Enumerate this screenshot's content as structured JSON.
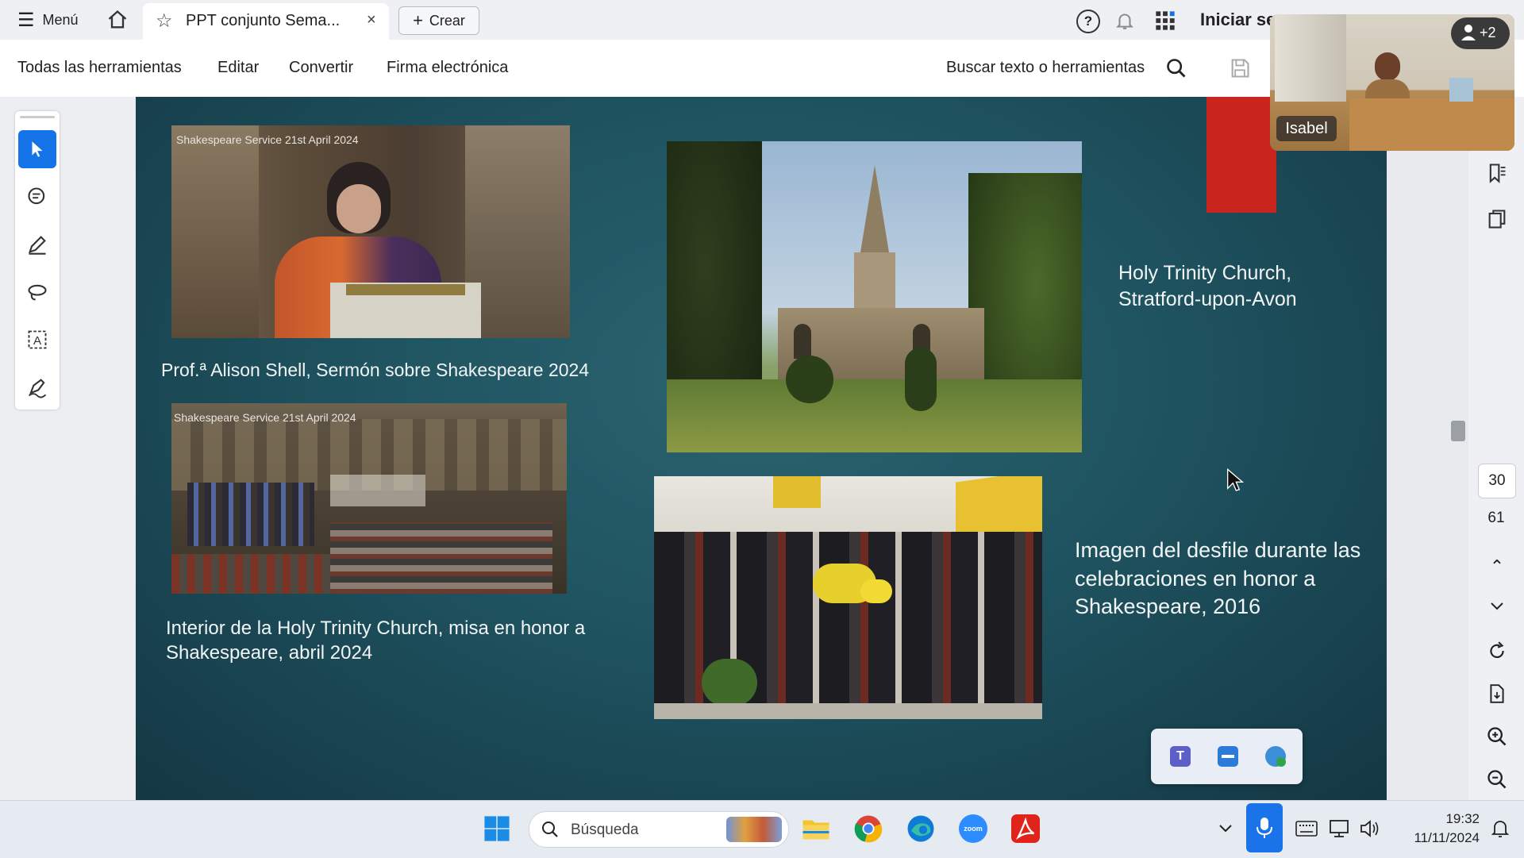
{
  "titlebar": {
    "menu_label": "Menú",
    "tab_title": "PPT conjunto Sema...",
    "create_label": "Crear",
    "signin_label": "Iniciar se"
  },
  "toolbar": {
    "items": [
      "Todas las herramientas",
      "Editar",
      "Convertir",
      "Firma electrónica"
    ],
    "search_label": "Buscar texto o herramientas"
  },
  "slide": {
    "photo1_overlay": "Shakespeare Service 21st April 2024",
    "caption1": "Prof.ª Alison Shell, Sermón sobre Shakespeare 2024",
    "photo2_overlay": "Shakespeare Service 21st April 2024",
    "caption2": "Interior de la Holy Trinity Church, misa en honor a Shakespeare, abril 2024",
    "caption_church": "Holy Trinity Church, Stratford-upon-Avon",
    "caption_parade": "Imagen del desfile durante las celebraciones en honor a Shakespeare, 2016"
  },
  "video": {
    "participant_name": "Isabel",
    "participants_badge": "+2"
  },
  "page_nav": {
    "current_page": "30",
    "total_pages": "61"
  },
  "taskbar": {
    "search_placeholder": "Búsqueda",
    "time": "19:32",
    "date": "11/11/2024"
  },
  "colors": {
    "accent_blue": "#1473e6",
    "slide_teal": "#1f5360",
    "red_block": "#c9241d"
  }
}
